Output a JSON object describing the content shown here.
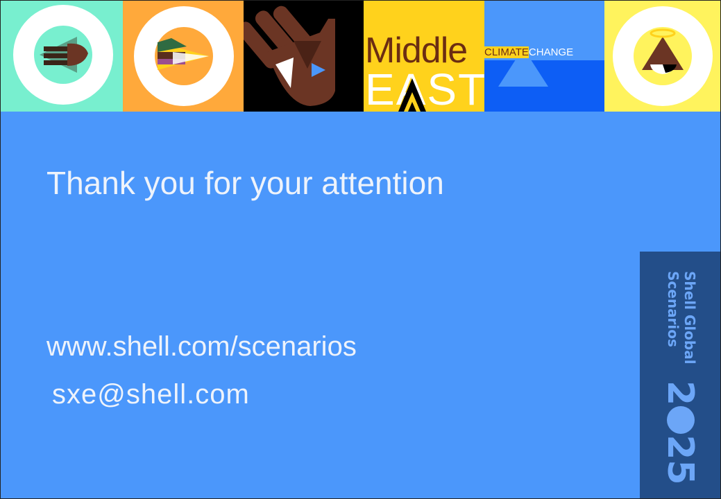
{
  "banner": {
    "tiles": [
      {
        "name": "hands-tile",
        "color": "#78efcf"
      },
      {
        "name": "landscape-tile",
        "color": "#ffa93b"
      },
      {
        "name": "raised-hand-tile",
        "color": "#000000"
      },
      {
        "name": "middle-east-tile",
        "color": "#ffd21c",
        "text_top": "Middle",
        "text_bottom": "EAST"
      },
      {
        "name": "climate-change-tile",
        "color": "#4b97fb",
        "text_word1": "CLIMATE",
        "text_word2": "CHANGE"
      },
      {
        "name": "halo-figure-tile",
        "color": "#fff35d"
      }
    ]
  },
  "slide": {
    "title": "Thank you for your attention",
    "url": "www.shell.com/scenarios",
    "email": "sxe@shell.com",
    "background_color": "#4b97fb"
  },
  "brand": {
    "line1": "Shell Global",
    "line2": "Scenarios",
    "year_prefix": "2",
    "year_suffix": "25",
    "color": "#234e89",
    "accent": "#6ca6f7"
  }
}
